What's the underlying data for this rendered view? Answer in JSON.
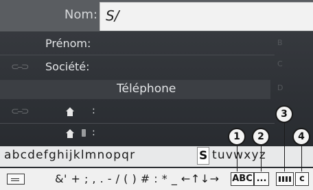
{
  "form": {
    "name_label": "Nom:",
    "name_value": "S/",
    "firstname_label": "Prénom:",
    "company_label": "Société:",
    "phone_header": "Téléphone",
    "home_colon": ":",
    "home_phone_colon": ":"
  },
  "alpha_index": [
    "B",
    "C",
    "D"
  ],
  "keyboard": {
    "chars_before": "abcdefghijklmnopqr",
    "selected_char": "S",
    "chars_after": "tuvwxyz",
    "special_chars": "&' + ; , . - / ( ) # : * _ ←↑↓→",
    "abc_label": "ABC",
    "dots_label": "...",
    "c_label": "c"
  },
  "callouts": [
    "1",
    "2",
    "3",
    "4"
  ]
}
